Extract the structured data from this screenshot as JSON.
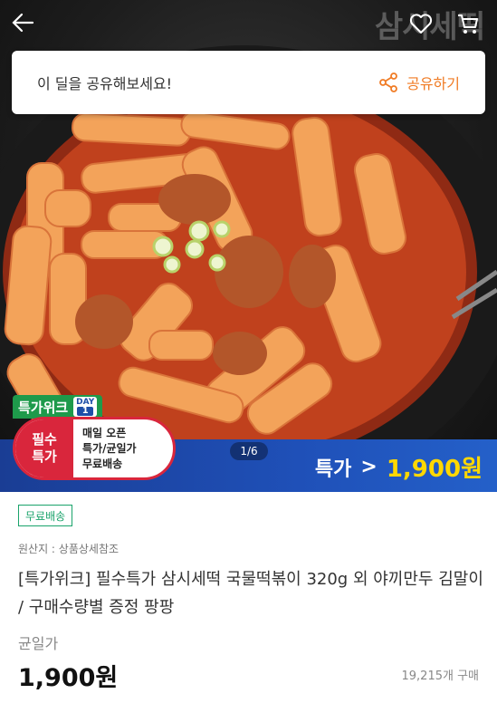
{
  "header": {
    "brand_watermark": "삼시세떡"
  },
  "share": {
    "prompt": "이 딜을 공유해보세요!",
    "button_label": "공유하기"
  },
  "promo": {
    "week_tag": "특가위크",
    "day_label": "DAY",
    "day_number": "1",
    "pill_top": "필수",
    "pill_bottom": "특가",
    "pill_lines": [
      "매일 오픈",
      "특가/균일가",
      "무료배송"
    ],
    "page_indicator": "1/6",
    "special_label": "특가",
    "special_arrow": ">",
    "special_price": "1,900원"
  },
  "product": {
    "free_shipping_badge": "무료배송",
    "origin": "원산지 : 상품상세참조",
    "title": "[특가위크] 필수특가 삼시세떡 국물떡볶이 320g 외 야끼만두 김말이 / 구매수량별 증정 팡팡",
    "price_label": "균일가",
    "price": "1,900원",
    "sold_count": "19,215개 구매"
  },
  "colors": {
    "accent_orange": "#f07b24",
    "promo_blue": "#1f50b8",
    "price_yellow": "#ffd800",
    "promo_red": "#d9263c",
    "free_green": "#1aa36b"
  }
}
